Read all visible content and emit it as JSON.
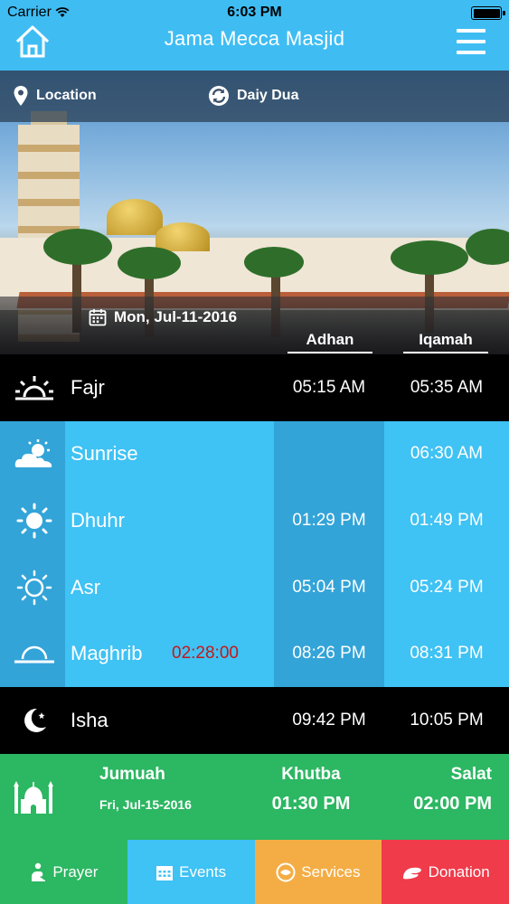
{
  "status_bar": {
    "carrier": "Carrier",
    "time": "6:03 PM"
  },
  "header": {
    "title": "Jama Mecca Masjid",
    "home_icon": "home-icon",
    "menu_icon": "hamburger-menu-icon"
  },
  "nav": {
    "location_label": "Location",
    "dua_label": "Daiy Dua"
  },
  "date": "Mon, Jul-11-2016",
  "columns": {
    "adhan": "Adhan",
    "iqamah": "Iqamah"
  },
  "prayers": [
    {
      "name": "Fajr",
      "adhan": "05:15 AM",
      "iqamah": "05:35 AM",
      "icon": "sunrise-horizon-icon"
    },
    {
      "name": "Sunrise",
      "adhan": "",
      "iqamah": "06:30 AM",
      "icon": "sun-cloud-icon"
    },
    {
      "name": "Dhuhr",
      "adhan": "01:29 PM",
      "iqamah": "01:49 PM",
      "icon": "sun-filled-icon"
    },
    {
      "name": "Asr",
      "adhan": "05:04 PM",
      "iqamah": "05:24 PM",
      "icon": "sun-outline-icon"
    },
    {
      "name": "Maghrib",
      "adhan": "08:26 PM",
      "iqamah": "08:31 PM",
      "countdown": "02:28:00",
      "icon": "sunset-icon"
    },
    {
      "name": "Isha",
      "adhan": "09:42 PM",
      "iqamah": "10:05 PM",
      "icon": "crescent-moon-icon"
    }
  ],
  "jumuah": {
    "label": "Jumuah",
    "date": "Fri, Jul-15-2016",
    "khutba_label": "Khutba",
    "khutba_time": "01:30 PM",
    "salat_label": "Salat",
    "salat_time": "02:00 PM"
  },
  "tabs": [
    {
      "label": "Prayer",
      "color": "#2cb762"
    },
    {
      "label": "Events",
      "color": "#3fc2f4"
    },
    {
      "label": "Services",
      "color": "#f4ad45"
    },
    {
      "label": "Donation",
      "color": "#ef3b4a"
    }
  ]
}
